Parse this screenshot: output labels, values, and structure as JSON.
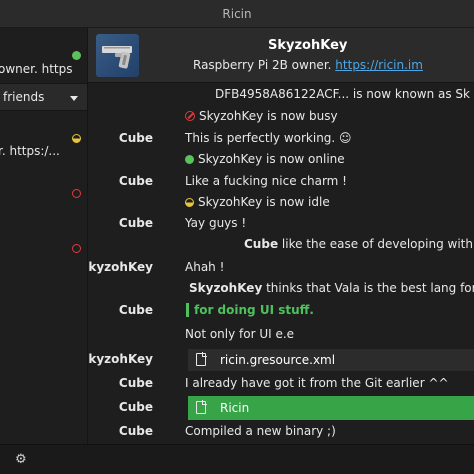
{
  "window": {
    "title": "Ricin"
  },
  "sidebar": {
    "contacts": [
      {
        "snippet": "owner. https",
        "status": "online"
      },
      {
        "snippet": "r. https:/...",
        "status": "idle"
      },
      {
        "snippet": "",
        "status": "offline"
      },
      {
        "snippet": "",
        "status": "offline"
      }
    ],
    "filter_label": "friends"
  },
  "header": {
    "name": "SkyzohKey",
    "status_text": "Raspberry Pi 2B owner.",
    "status_link": "https://ricin.im"
  },
  "messages": [
    {
      "type": "info",
      "text": "DFB4958A86122ACF... is now known as Sk"
    },
    {
      "type": "status",
      "icon": "busy",
      "text": "SkyzohKey is now busy"
    },
    {
      "type": "chat",
      "sender": "Cube",
      "text": "This is perfectly working. ☺"
    },
    {
      "type": "status",
      "icon": "online",
      "text": "SkyzohKey is now online"
    },
    {
      "type": "chat",
      "sender": "Cube",
      "text": "Like a fucking nice charm !"
    },
    {
      "type": "status",
      "icon": "idle",
      "text": "SkyzohKey is now idle"
    },
    {
      "type": "chat",
      "sender": "Cube",
      "text": "Yay guys !"
    },
    {
      "type": "action",
      "actor": "Cube",
      "text": "like the ease of developing with Vi"
    },
    {
      "type": "chat",
      "sender": "SkyzohKey",
      "text": "Ahah !"
    },
    {
      "type": "action",
      "actor": "SkyzohKey",
      "text": "thinks that Vala is the best lang for de"
    },
    {
      "type": "quote",
      "sender": "Cube",
      "text": "for doing UI stuff."
    },
    {
      "type": "chat",
      "sender": "",
      "text": "Not only for UI e.e"
    },
    {
      "type": "file",
      "sender": "SkyzohKey",
      "filename": "ricin.gresource.xml"
    },
    {
      "type": "chat",
      "sender": "Cube",
      "text": "I already have got it from the Git earlier ^^"
    },
    {
      "type": "file",
      "sender": "Cube",
      "filename": "Ricin",
      "highlight": true
    },
    {
      "type": "chat",
      "sender": "Cube",
      "text": "Compiled a new binary ;)"
    }
  ],
  "colors": {
    "accent_link": "#4ea6e6",
    "online": "#5bc15a",
    "busy": "#e33a3a",
    "idle": "#e8c53a",
    "file_highlight": "#37a447"
  },
  "icons": {
    "settings": "gear-icon",
    "file": "file-icon"
  }
}
